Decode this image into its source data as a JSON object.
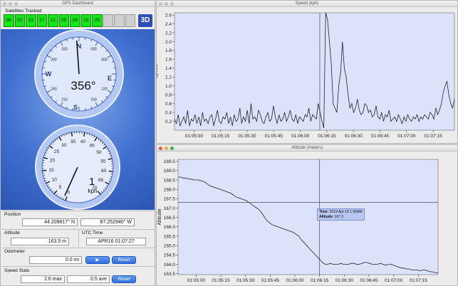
{
  "dashboard": {
    "title": "GPS Dashboard",
    "satellites_label": "Satellites Tracked",
    "satellites": [
      "06",
      "02",
      "23",
      "17",
      "12",
      "05",
      "09",
      "19",
      "25"
    ],
    "fix_label": "3D",
    "compass": {
      "heading_text": "356°",
      "heading_deg": 356,
      "north": "N",
      "south": "S",
      "east": "E",
      "west": "W",
      "degree_labels": [
        "030",
        "060",
        "120",
        "150",
        "210",
        "240",
        "300",
        "330"
      ]
    },
    "speedometer": {
      "value_text": "1",
      "unit": "kph",
      "value": 1,
      "labels": [
        "0",
        "5",
        "10",
        "15",
        "20",
        "25",
        "30",
        "35",
        "40",
        "45",
        "50",
        "55",
        "60",
        "65",
        "70"
      ]
    },
    "position": {
      "label": "Position",
      "lat": "44.209817° N",
      "lon": "87.252940° W"
    },
    "altitude": {
      "label": "Altitude",
      "value": "163.5 m"
    },
    "utc": {
      "label": "UTC Time",
      "value": "APR16 01:07:27"
    },
    "odometer": {
      "label": "Odometer",
      "value": "0.0 mi",
      "play": "▶",
      "reset": "Reset"
    },
    "speed_stats": {
      "label": "Speed Stats",
      "max": "2.6 max",
      "ave": "0.5 ave",
      "reset": "Reset"
    }
  },
  "speed_window": {
    "title": "Speed (kph)"
  },
  "altitude_window": {
    "title": "Altitude (meters)",
    "tooltip_time_label": "Time:",
    "tooltip_time": "2019 Apr-16 1:06AM",
    "tooltip_alt_label": "Altitude:",
    "tooltip_alt": "167.3"
  },
  "chart_data": [
    {
      "type": "line",
      "title": "Speed (kph)",
      "ylabel": "Speed",
      "xlabel": "",
      "ylim": [
        0,
        2.65
      ],
      "yticks": [
        0.2,
        0.4,
        0.6,
        0.8,
        1.0,
        1.2,
        1.4,
        1.6,
        1.8,
        2.0,
        2.2,
        2.4,
        2.6
      ],
      "ytick_labels": [
        "0.2",
        "0.4",
        "0.6",
        "0.8",
        "1.0",
        "1.2",
        "1.4",
        "1.6",
        "1.8",
        "2.0",
        "2.2",
        "2.4",
        "2.6"
      ],
      "xtick_labels": [
        "01:05:00",
        "01:05:15",
        "01:05:30",
        "01:05:45",
        "01:06:00",
        "01:06:15",
        "01:06:30",
        "01:06:45",
        "01:07:00",
        "01:07:15"
      ],
      "x_start": "01:04:49",
      "x_end": "01:07:27",
      "values": [
        0.25,
        0.15,
        0.35,
        0.1,
        0.2,
        0.3,
        0.15,
        0.45,
        0.1,
        0.25,
        0.2,
        0.35,
        0.15,
        0.3,
        0.1,
        0.4,
        0.2,
        0.25,
        0.15,
        0.3,
        0.35,
        0.1,
        0.25,
        0.45,
        0.2,
        0.15,
        0.3,
        0.25,
        0.4,
        0.15,
        0.3,
        0.1,
        0.35,
        0.2,
        0.25,
        0.5,
        0.15,
        0.3,
        0.2,
        0.45,
        0.15,
        0.6,
        0.25,
        0.3,
        0.2,
        0.45,
        0.35,
        0.2,
        0.15,
        0.3,
        0.4,
        0.2,
        0.25,
        0.55,
        0.3,
        0.15,
        0.35,
        0.2,
        0.25,
        0.4,
        0.2,
        0.3,
        0.45,
        0.25,
        0.2,
        0.35,
        0.15,
        0.3,
        0.25,
        0.2,
        0.35,
        0.3,
        0.5,
        0.2,
        0.35,
        0.3,
        0.25,
        0.6,
        0.4,
        0.2,
        0.05,
        2.65,
        2.5,
        2.0,
        1.5,
        0.6,
        0.5,
        0.4,
        1.0,
        1.3,
        2.0,
        1.4,
        1.2,
        0.8,
        0.5,
        0.6,
        0.4,
        0.5,
        0.7,
        0.45,
        0.35,
        0.4,
        0.6,
        0.55,
        0.4,
        0.45,
        0.3,
        0.35,
        0.55,
        0.3,
        0.25,
        0.4,
        0.2,
        0.35,
        0.3,
        0.45,
        0.2,
        0.25,
        0.3,
        0.2,
        0.35,
        0.25,
        0.15,
        0.3,
        0.2,
        0.35,
        0.25,
        0.2,
        0.3,
        0.25,
        0.35,
        0.2,
        0.3,
        0.25,
        0.35,
        0.3,
        0.25,
        0.4,
        0.35,
        0.25,
        0.5,
        0.35,
        0.45,
        0.6,
        0.85,
        1.0,
        1.1,
        0.8,
        0.6,
        0.5,
        0.7
      ]
    },
    {
      "type": "line",
      "title": "Altitude (meters)",
      "ylabel": "Altitude",
      "xlabel": "",
      "ylim": [
        163.45,
        169.6
      ],
      "yticks": [
        163.5,
        164.0,
        164.5,
        165.0,
        165.5,
        166.0,
        166.5,
        167.0,
        167.5,
        168.0,
        168.5,
        169.0,
        169.5
      ],
      "ytick_labels": [
        "163.5",
        "164.0",
        "164.5",
        "165.0",
        "165.5",
        "166.0",
        "166.5",
        "167.0",
        "167.5",
        "168.0",
        "168.5",
        "169.0",
        "169.5"
      ],
      "xtick_labels": [
        "01:05:00",
        "01:05:15",
        "01:05:30",
        "01:05:45",
        "01:06:00",
        "01:06:15",
        "01:06:30",
        "01:06:45",
        "01:07:00",
        "01:07:15"
      ],
      "x_start": "01:04:49",
      "x_end": "01:07:27",
      "values": [
        168.65,
        168.65,
        168.6,
        168.6,
        168.55,
        168.55,
        168.5,
        168.5,
        168.5,
        168.45,
        168.4,
        168.3,
        168.2,
        168.15,
        168.1,
        168.05,
        168.0,
        167.95,
        167.9,
        167.85,
        167.8,
        167.7,
        167.6,
        167.55,
        167.5,
        167.45,
        167.4,
        167.3,
        167.2,
        167.1,
        167.0,
        166.9,
        166.7,
        166.5,
        166.3,
        166.2,
        166.1,
        166.05,
        166.0,
        165.95,
        165.9,
        165.85,
        165.8,
        165.75,
        165.7,
        165.6,
        165.5,
        165.3,
        165.15,
        165.0,
        164.85,
        164.7,
        164.55,
        164.4,
        164.25,
        164.1,
        164.0,
        164.0,
        164.05,
        164.0,
        164.0,
        164.0,
        164.05,
        164.0,
        164.0,
        164.0,
        164.05,
        164.05,
        164.0,
        164.0,
        164.05,
        164.1,
        164.1,
        164.05,
        164.0,
        164.0,
        164.0,
        164.05,
        164.0,
        163.95,
        164.0,
        164.0,
        163.95,
        163.9,
        163.85,
        163.8,
        163.8,
        163.75,
        163.75,
        163.7,
        163.7,
        163.7,
        163.65,
        163.7,
        163.7,
        163.65,
        163.6,
        163.6,
        163.55,
        163.55
      ]
    }
  ]
}
